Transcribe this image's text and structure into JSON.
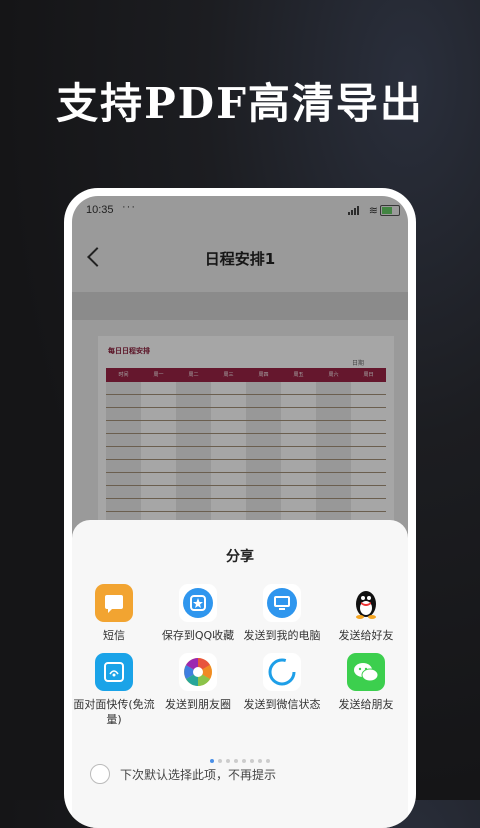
{
  "headline": "支持PDF高清导出",
  "status": {
    "time": "10:35",
    "dots": "···",
    "wifi": "≋",
    "battery": ""
  },
  "nav": {
    "title": "日程安排1"
  },
  "doc": {
    "title": "每日日程安排",
    "date": "日期",
    "columns": [
      "时间",
      "周一",
      "周二",
      "周三",
      "周四",
      "周五",
      "周六",
      "周日"
    ]
  },
  "sheet": {
    "title": "分享",
    "row1": [
      {
        "label": "短信",
        "icon": "sms-icon",
        "color": "#f2a431"
      },
      {
        "label": "保存到QQ收藏",
        "icon": "qq-favorites-icon",
        "color": "#2f96ee"
      },
      {
        "label": "发送到我的电脑",
        "icon": "my-computer-icon",
        "color": "#2f96ee"
      },
      {
        "label": "发送给好友",
        "icon": "qq-penguin-icon",
        "color": "#111111"
      }
    ],
    "row2": [
      {
        "label": "面对面快传(免流量)",
        "icon": "face-to-face-transfer-icon",
        "color": "#1aa3e8"
      },
      {
        "label": "发送到朋友圈",
        "icon": "moments-icon",
        "color": "#e8533d"
      },
      {
        "label": "发送到微信状态",
        "icon": "wechat-status-icon",
        "color": "#1e9fe8"
      },
      {
        "label": "发送给朋友",
        "icon": "wechat-icon",
        "color": "#3ccf4e"
      }
    ],
    "checkbox_label": "下次默认选择此项，不再提示"
  }
}
